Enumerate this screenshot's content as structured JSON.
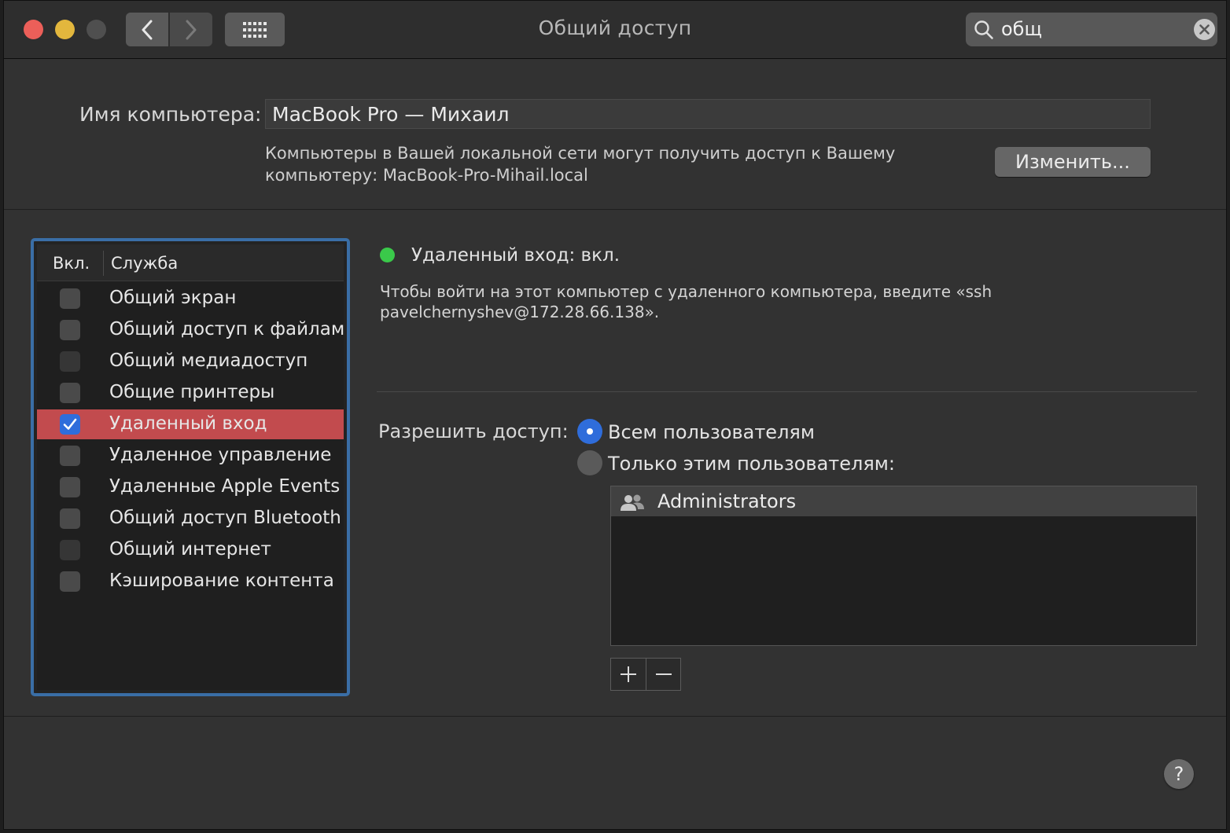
{
  "window": {
    "title": "Общий доступ"
  },
  "toolbar": {
    "back_icon": "chevron-left-icon",
    "forward_icon": "chevron-right-icon",
    "grid_icon": "grid-icon"
  },
  "search": {
    "value": "общ",
    "icon": "search-icon",
    "clear_icon": "clear-icon"
  },
  "computer_name": {
    "label": "Имя компьютера:",
    "value": "MacBook Pro — Михаил",
    "description_line1": "Компьютеры в Вашей локальной сети могут получить доступ к Вашему",
    "description_line2": "компьютеру: MacBook-Pro-Mihail.local",
    "change_button": "Изменить..."
  },
  "services": {
    "header_on": "Вкл.",
    "header_service": "Служба",
    "items": [
      {
        "label": "Общий экран",
        "checked": false
      },
      {
        "label": "Общий доступ к файлам",
        "checked": false
      },
      {
        "label": "Общий медиадоступ",
        "checked": false
      },
      {
        "label": "Общие принтеры",
        "checked": false
      },
      {
        "label": "Удаленный вход",
        "checked": true
      },
      {
        "label": "Удаленное управление",
        "checked": false
      },
      {
        "label": "Удаленные Apple Events",
        "checked": false
      },
      {
        "label": "Общий доступ Bluetooth",
        "checked": false
      },
      {
        "label": "Общий интернет",
        "checked": false
      },
      {
        "label": "Кэширование контента",
        "checked": false
      }
    ]
  },
  "detail": {
    "status": "Удаленный вход: вкл.",
    "status_color": "#3ac94a",
    "instructions_line1": "Чтобы войти на этот компьютер с удаленного компьютера, введите «ssh",
    "instructions_line2": "pavelchernyshev@172.28.66.138».",
    "allow_label": "Разрешить доступ:",
    "option_all": "Всем пользователям",
    "option_only": "Только этим пользователям:",
    "users": [
      {
        "name": "Administrators",
        "icon": "group-icon"
      }
    ],
    "add_icon": "plus-icon",
    "remove_icon": "minus-icon"
  },
  "help": {
    "label": "?"
  },
  "colors": {
    "accent": "#2f6ddb",
    "selection": "#c24b4e",
    "focus_ring": "#3a6ea6"
  }
}
